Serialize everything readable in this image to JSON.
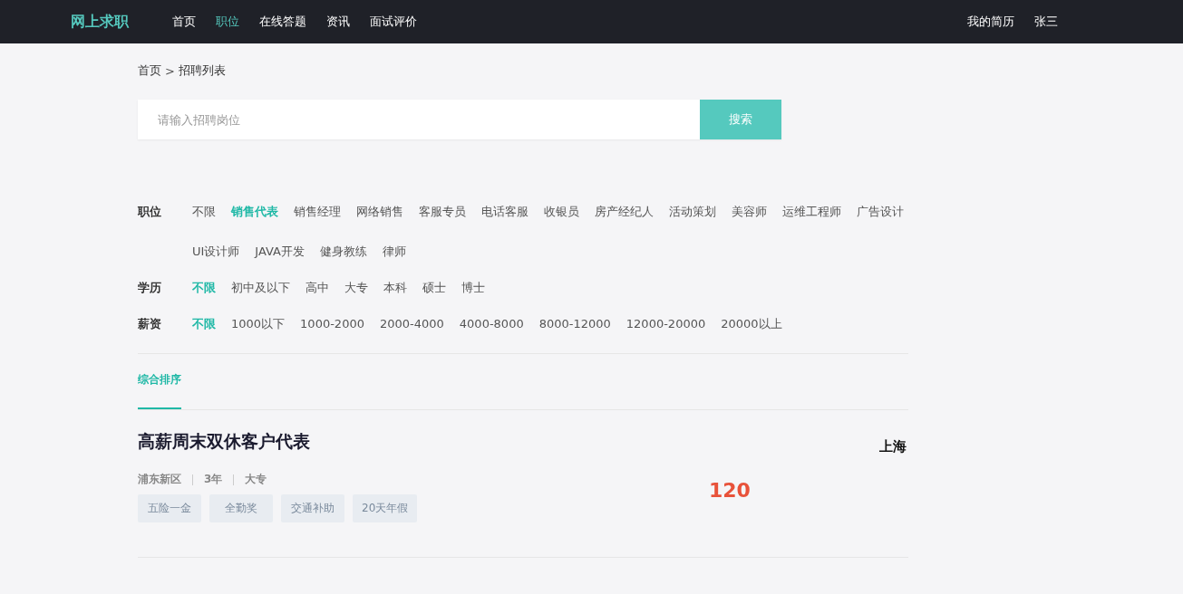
{
  "nav": {
    "logo": "网上求职",
    "items": [
      {
        "label": "首页",
        "selected": false
      },
      {
        "label": "职位",
        "selected": true
      },
      {
        "label": "在线答题",
        "selected": false
      },
      {
        "label": "资讯",
        "selected": false
      },
      {
        "label": "面试评价",
        "selected": false
      }
    ],
    "right": [
      "我的简历",
      "张三"
    ]
  },
  "breadcrumb": [
    "首页",
    "招聘列表"
  ],
  "breadcrumb_separator": ">",
  "search": {
    "placeholder": "请输入招聘岗位",
    "button": "搜索"
  },
  "filters": [
    {
      "label": "职位",
      "options": [
        {
          "label": "不限",
          "selected": false
        },
        {
          "label": "销售代表",
          "selected": true
        },
        {
          "label": "销售经理",
          "selected": false
        },
        {
          "label": "网络销售",
          "selected": false
        },
        {
          "label": "客服专员",
          "selected": false
        },
        {
          "label": "电话客服",
          "selected": false
        },
        {
          "label": "收银员",
          "selected": false
        },
        {
          "label": "房产经纪人",
          "selected": false
        },
        {
          "label": "活动策划",
          "selected": false
        },
        {
          "label": "美容师",
          "selected": false
        },
        {
          "label": "运维工程师",
          "selected": false
        },
        {
          "label": "广告设计",
          "selected": false
        },
        {
          "label": "UI设计师",
          "selected": false
        },
        {
          "label": "JAVA开发",
          "selected": false
        },
        {
          "label": "健身教练",
          "selected": false
        },
        {
          "label": "律师",
          "selected": false
        }
      ]
    },
    {
      "label": "学历",
      "options": [
        {
          "label": "不限",
          "selected": true
        },
        {
          "label": "初中及以下",
          "selected": false
        },
        {
          "label": "高中",
          "selected": false
        },
        {
          "label": "大专",
          "selected": false
        },
        {
          "label": "本科",
          "selected": false
        },
        {
          "label": "硕士",
          "selected": false
        },
        {
          "label": "博士",
          "selected": false
        }
      ]
    },
    {
      "label": "薪资",
      "options": [
        {
          "label": "不限",
          "selected": true
        },
        {
          "label": "1000以下",
          "selected": false
        },
        {
          "label": "1000-2000",
          "selected": false
        },
        {
          "label": "2000-4000",
          "selected": false
        },
        {
          "label": "4000-8000",
          "selected": false
        },
        {
          "label": "8000-12000",
          "selected": false
        },
        {
          "label": "12000-20000",
          "selected": false
        },
        {
          "label": "20000以上",
          "selected": false
        }
      ]
    }
  ],
  "sort_tabs": [
    {
      "label": "综合排序",
      "selected": true
    }
  ],
  "jobs": [
    {
      "title": "高薪周末双休客户代表",
      "meta": [
        "浦东新区",
        "3年",
        "大专"
      ],
      "tags": [
        "五险一金",
        "全勤奖",
        "交通补助",
        "20天年假"
      ],
      "city": "上海",
      "salary": "120"
    }
  ]
}
